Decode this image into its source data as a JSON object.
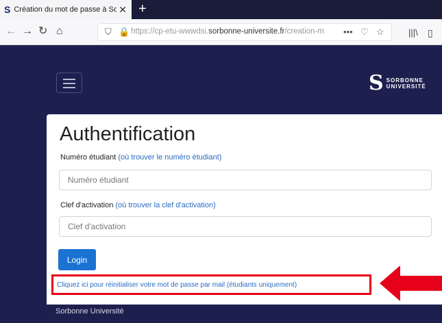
{
  "browser": {
    "tab_title": "Création du mot de passe à Sor",
    "tab_icon": "S",
    "tab_close": "✕",
    "new_tab": "+",
    "url_plain": "https://cp-etu-wwwdsi.",
    "url_domain": "sorbonne-universite.fr",
    "url_path": "/creation-m",
    "url_more": "•••"
  },
  "header": {
    "logo_line1": "SORBONNE",
    "logo_line2": "UNIVERSITÉ"
  },
  "form": {
    "title": "Authentification",
    "student_label": "Numéro étudiant",
    "student_help": "(où trouver le numéro étudiant)",
    "student_placeholder": "Numéro étudiant",
    "key_label": "Clef d'activation",
    "key_help": "(où trouver la clef d'activation)",
    "key_placeholder": "Clef d'activation",
    "login_label": "Login",
    "reset_link": "Cliquez ici pour réinitialiser votre mot de passe par mail (étudiants uniquement)"
  },
  "footer": {
    "text": "Sorbonne Université"
  },
  "colors": {
    "navy": "#1d1f4e",
    "button": "#1a72d3",
    "highlight": "#e6001a",
    "link": "#2a6bbf"
  }
}
